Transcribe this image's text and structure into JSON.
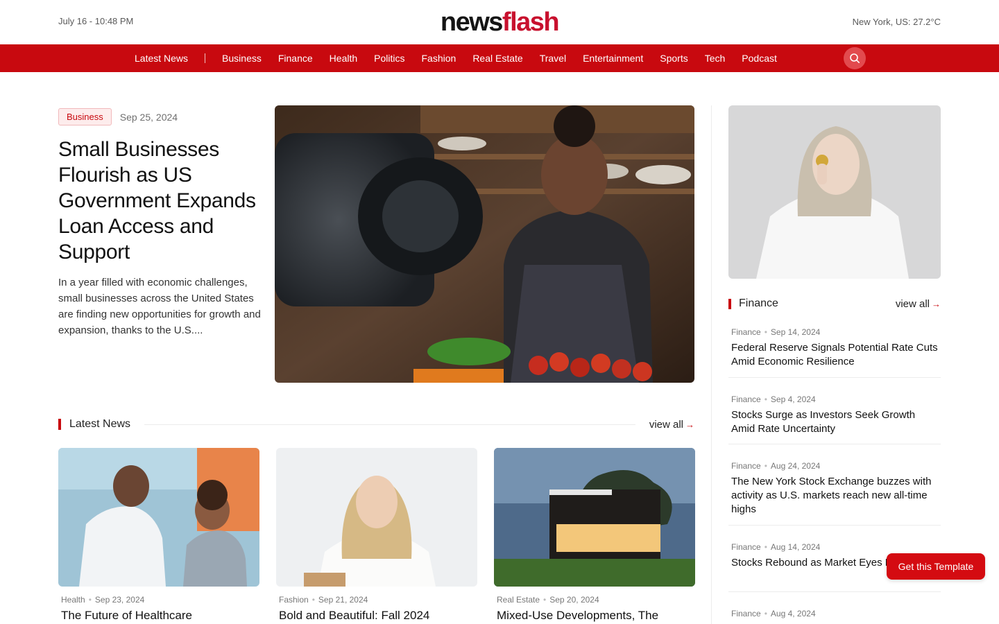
{
  "topbar": {
    "date": "July 16 - 10:48 PM",
    "logo_part1": "news",
    "logo_part2": "flash",
    "weather": "New York, US: 27.2°C"
  },
  "nav": {
    "items": [
      "Latest News",
      "Business",
      "Finance",
      "Health",
      "Politics",
      "Fashion",
      "Real Estate",
      "Travel",
      "Entertainment",
      "Sports",
      "Tech",
      "Podcast"
    ],
    "search_icon": "search-icon"
  },
  "hero": {
    "category": "Business",
    "date": "Sep 25, 2024",
    "title": "Small Businesses Flourish as US Government Expands Loan Access and Support",
    "excerpt": "In a year filled with economic challenges, small businesses across the United States are finding new opportunities for growth and expansion, thanks to the U.S...."
  },
  "latest": {
    "title": "Latest News",
    "view_all": "view all",
    "cards": [
      {
        "category": "Health",
        "date": "Sep 23, 2024",
        "title": "The Future of Healthcare"
      },
      {
        "category": "Fashion",
        "date": "Sep 21, 2024",
        "title": "Bold and Beautiful: Fall 2024"
      },
      {
        "category": "Real Estate",
        "date": "Sep 20, 2024",
        "title": "Mixed-Use Developments, The"
      }
    ]
  },
  "sidebar": {
    "title": "Finance",
    "view_all": "view all",
    "items": [
      {
        "category": "Finance",
        "date": "Sep 14, 2024",
        "title": "Federal Reserve Signals Potential Rate Cuts Amid Economic Resilience"
      },
      {
        "category": "Finance",
        "date": "Sep 4, 2024",
        "title": "Stocks Surge as Investors Seek Growth Amid Rate Uncertainty"
      },
      {
        "category": "Finance",
        "date": "Aug 24, 2024",
        "title": "The New York Stock Exchange buzzes with activity as U.S. markets reach new all-time highs"
      },
      {
        "category": "Finance",
        "date": "Aug 14, 2024",
        "title": "Stocks Rebound as Market Eyes Rate Cuts"
      },
      {
        "category": "Finance",
        "date": "Aug 4, 2024",
        "title": ""
      }
    ]
  },
  "cta": {
    "label": "Get this Template"
  },
  "colors": {
    "accent": "#c8090f",
    "text": "#111111",
    "muted": "#777777"
  }
}
